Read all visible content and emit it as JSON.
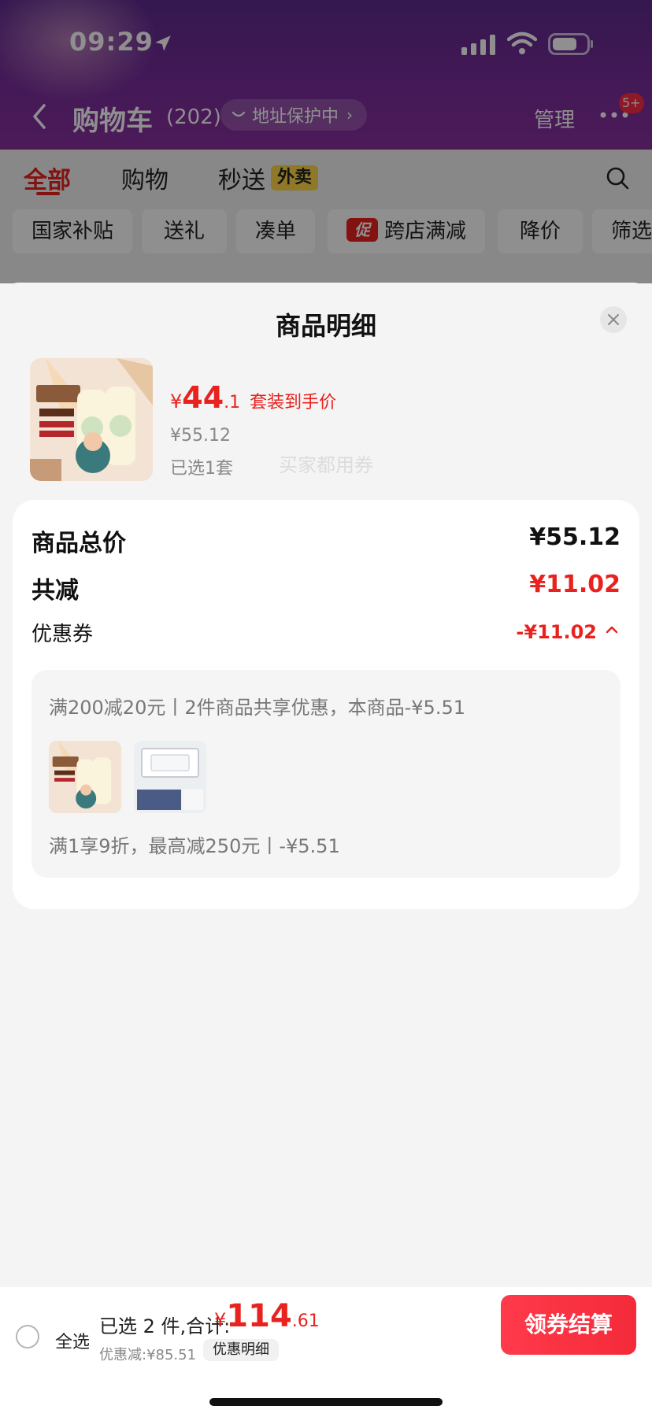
{
  "status_bar": {
    "time": "09:29"
  },
  "nav": {
    "title": "购物车",
    "count": "(202)",
    "address_protection": "地址保护中",
    "manage": "管理",
    "more_badge": "5+"
  },
  "tabs": [
    {
      "label": "全部"
    },
    {
      "label": "购物"
    },
    {
      "label": "秒送"
    }
  ],
  "waimai_badge": "外卖",
  "filters": [
    {
      "label": "国家补贴"
    },
    {
      "label": "送礼"
    },
    {
      "label": "凑单"
    },
    {
      "label": "跨店满减",
      "tag": "促"
    },
    {
      "label": "降价"
    },
    {
      "label": "筛选"
    }
  ],
  "sheet": {
    "title": "商品明细",
    "product": {
      "price_symbol": "¥",
      "price_int": "44",
      "price_dec": ".1",
      "price_label": "套装到手价",
      "original_price": "¥55.12",
      "selected": "已选1套"
    },
    "summary": {
      "total_label": "商品总价",
      "total_value": "¥55.12",
      "reduce_label": "共减",
      "reduce_value": "¥11.02",
      "coupon_label": "优惠券",
      "coupon_value": "-¥11.02"
    },
    "watermark": "买家都用券",
    "coupons": {
      "line1": "满200减20元丨2件商品共享优惠，本商品-¥5.51",
      "line2": "满1享9折，最高减250元丨-¥5.51"
    }
  },
  "checkout": {
    "select_all": "全选",
    "selected_count": "已选 2 件,合计:",
    "total_symbol": "¥",
    "total_int": "114",
    "total_dec": ".61",
    "discount": "优惠减:¥85.51",
    "detail_button": "优惠明细",
    "checkout_button": "领券结算"
  },
  "colors": {
    "accent_red": "#e8231f",
    "header_purple": "#6a2c94",
    "badge_yellow": "#ffd84a"
  }
}
